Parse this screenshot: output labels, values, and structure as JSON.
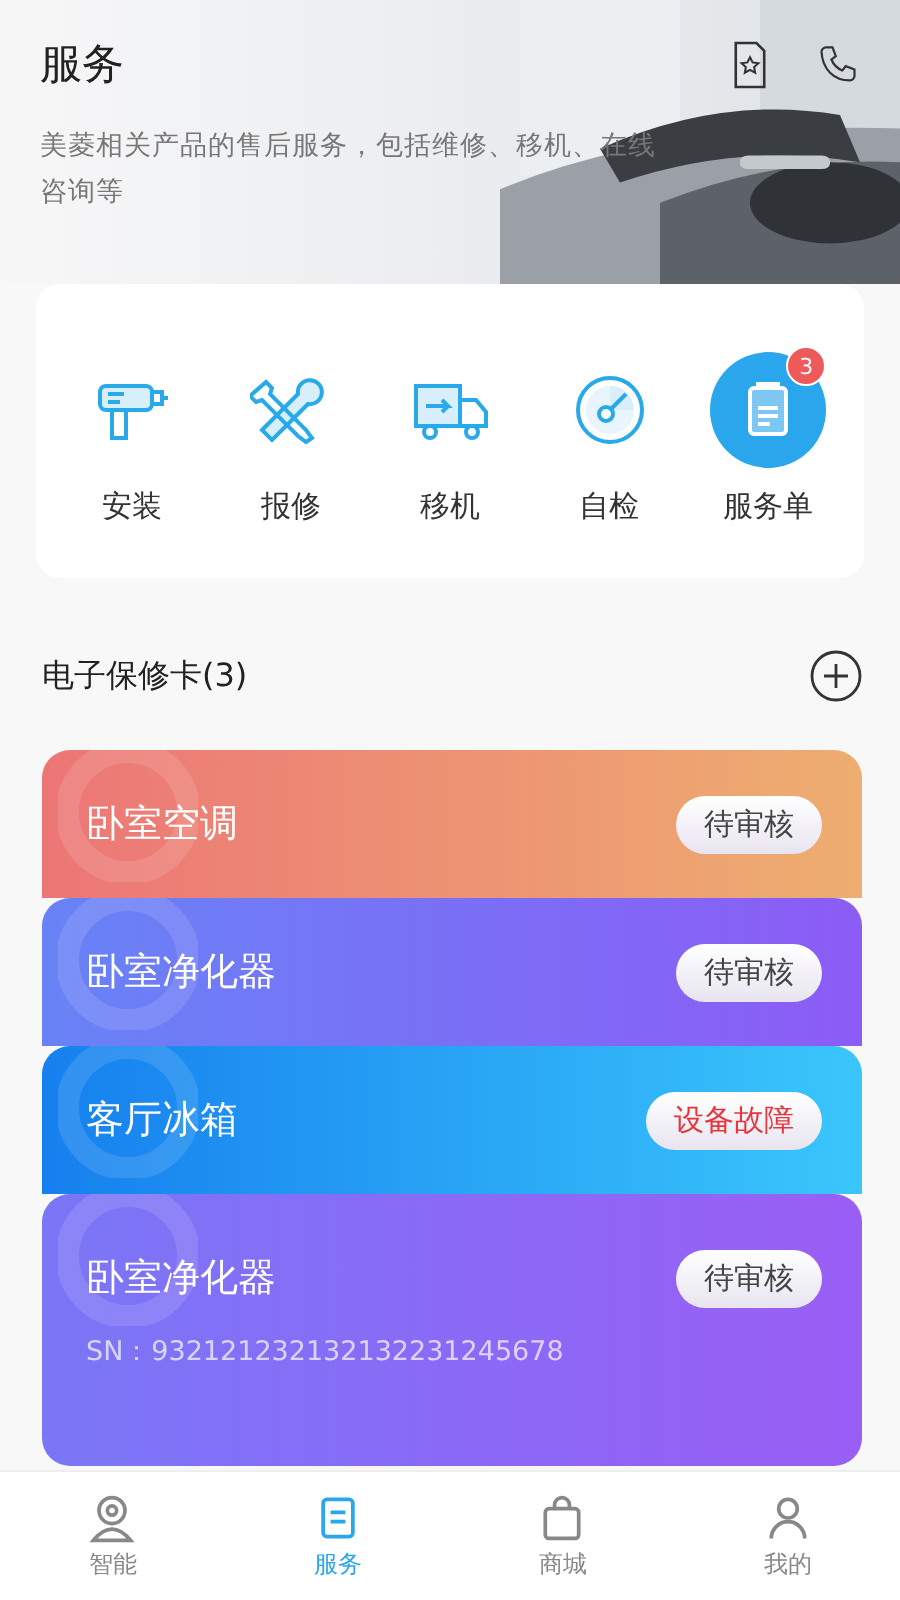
{
  "header": {
    "title": "服务",
    "description": "美菱相关产品的售后服务，包括维修、移机、在线咨询等"
  },
  "services": [
    {
      "kind": "drill",
      "label": "安装",
      "highlighted": false
    },
    {
      "kind": "tools",
      "label": "报修",
      "highlighted": false
    },
    {
      "kind": "truck",
      "label": "移机",
      "highlighted": false
    },
    {
      "kind": "gauge",
      "label": "自检",
      "highlighted": false
    },
    {
      "kind": "doc",
      "label": "服务单",
      "highlighted": true,
      "badge": "3"
    }
  ],
  "warranty": {
    "title": "电子保修卡(3)"
  },
  "cards": [
    {
      "kind": "orange",
      "name": "卧室空调",
      "status": "待审核",
      "warning": false
    },
    {
      "kind": "violet",
      "name": "卧室净化器",
      "status": "待审核",
      "warning": false
    },
    {
      "kind": "blue",
      "name": "客厅冰箱",
      "status": "设备故障",
      "warning": true
    },
    {
      "kind": "purple",
      "name": "卧室净化器",
      "status": "待审核",
      "warning": false,
      "sn": "SN：932121232132132231245678"
    }
  ],
  "tabbar": [
    {
      "kind": "camera",
      "label": "智能",
      "selected": false
    },
    {
      "kind": "service",
      "label": "服务",
      "selected": true
    },
    {
      "kind": "bag",
      "label": "商城",
      "selected": false
    },
    {
      "kind": "person",
      "label": "我的",
      "selected": false
    }
  ]
}
